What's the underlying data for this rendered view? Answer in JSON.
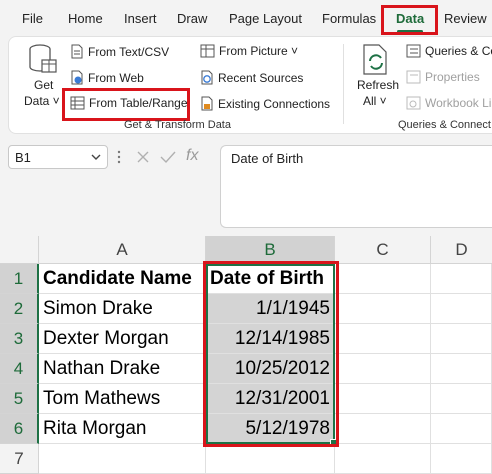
{
  "tabs": [
    "File",
    "Home",
    "Insert",
    "Draw",
    "Page Layout",
    "Formulas",
    "Data",
    "Review"
  ],
  "active_tab": "Data",
  "ribbon": {
    "get_data": {
      "line1": "Get",
      "line2": "Data ˅"
    },
    "from_text_csv": "From Text/CSV",
    "from_web": "From Web",
    "from_table_range": "From Table/Range",
    "from_picture": "From Picture ˅",
    "recent_sources": "Recent Sources",
    "existing_connections": "Existing Connections",
    "group_get_transform": "Get & Transform Data",
    "refresh": {
      "line1": "Refresh",
      "line2": "All ˅"
    },
    "queries_connections": "Queries & Co",
    "properties": "Properties",
    "workbook_links": "Workbook Li",
    "group_queries": "Queries & Connect"
  },
  "formula_bar": {
    "name_box": "B1",
    "formula": "Date of Birth",
    "fx": "fx"
  },
  "sheet": {
    "columns": [
      "A",
      "B",
      "C",
      "D"
    ],
    "rows": [
      {
        "num": "1",
        "a": "Candidate Name",
        "b": "Date of Birth"
      },
      {
        "num": "2",
        "a": "Simon Drake",
        "b": "1/1/1945"
      },
      {
        "num": "3",
        "a": "Dexter Morgan",
        "b": "12/14/1985"
      },
      {
        "num": "4",
        "a": "Nathan Drake",
        "b": "10/25/2012"
      },
      {
        "num": "5",
        "a": "Tom Mathews",
        "b": "12/31/2001"
      },
      {
        "num": "6",
        "a": "Rita Morgan",
        "b": "5/12/1978"
      },
      {
        "num": "7",
        "a": "",
        "b": ""
      }
    ],
    "selected_cell": "B1"
  },
  "colors": {
    "accent": "#1e7145",
    "highlight": "#d9141b",
    "selection": "#d4d4d4"
  }
}
